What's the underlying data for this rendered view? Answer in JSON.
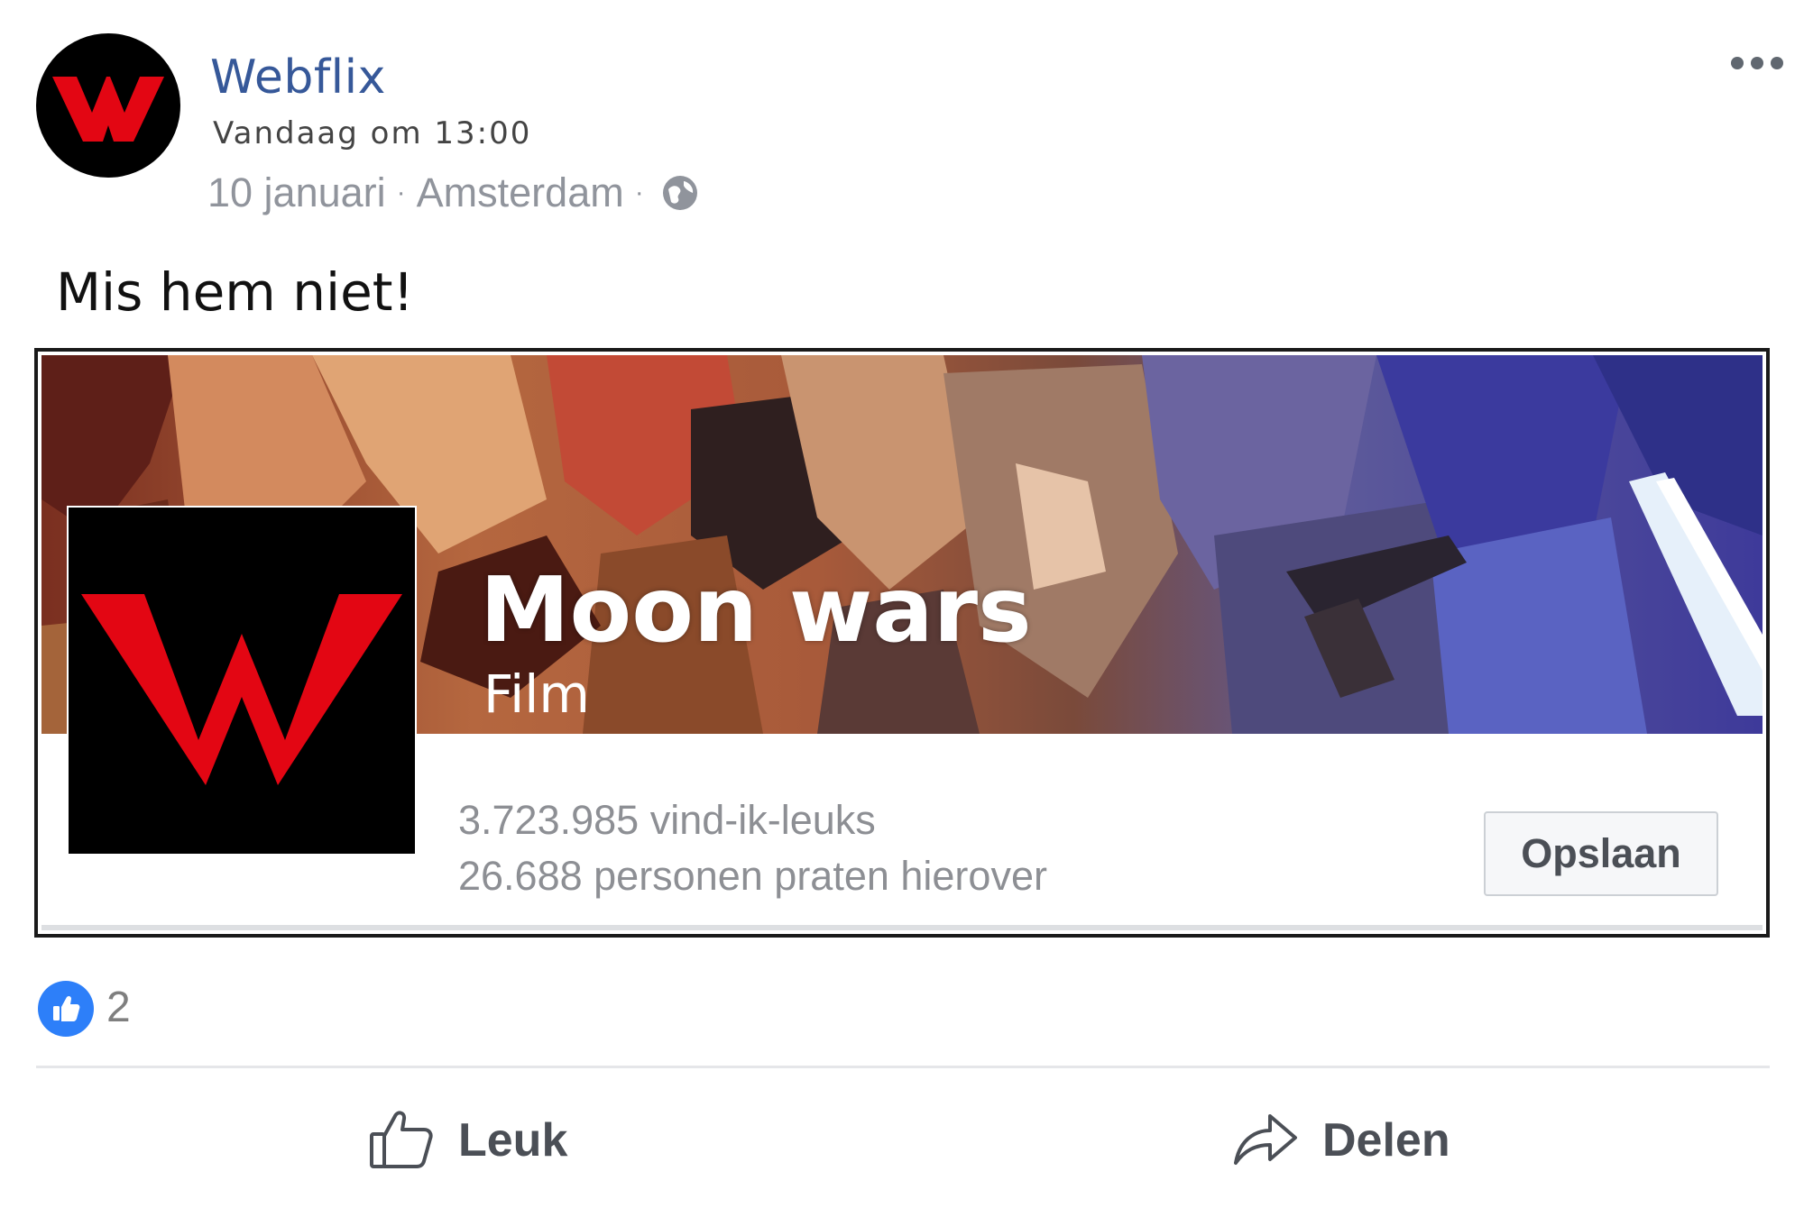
{
  "post": {
    "author": "Webflix",
    "timestamp": "Vandaag om 13:00",
    "date": "10 januari",
    "separator": "·",
    "location": "Amsterdam",
    "privacy_icon": "globe-icon",
    "text": "Mis hem niet!"
  },
  "card": {
    "title": "Moon wars",
    "category": "Film",
    "likes": "3.723.985 vind-ik-leuks",
    "talking": "26.688 personen praten hierover",
    "save_label": "Opslaan"
  },
  "reactions": {
    "icon": "thumbs-up-icon",
    "count": "2"
  },
  "actions": {
    "like_label": "Leuk",
    "share_label": "Delen"
  },
  "colors": {
    "brand_red": "#e30613",
    "link_blue": "#365899",
    "like_blue": "#2d7ff9",
    "muted": "#90949c"
  }
}
